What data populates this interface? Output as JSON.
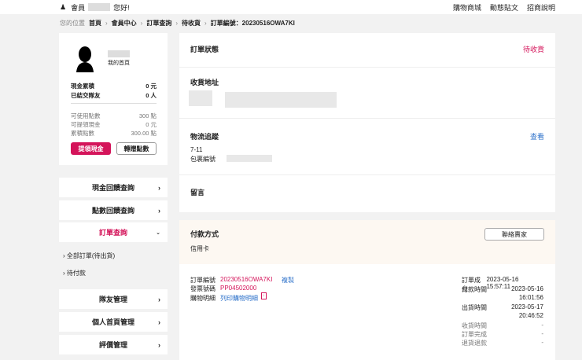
{
  "topbar": {
    "greeting_prefix": "會員",
    "greeting_suffix": "您好!",
    "nav": [
      "購物商城",
      "動態貼文",
      "招商說明"
    ]
  },
  "breadcrumb": {
    "label": "您的位置",
    "items": [
      "首頁",
      "會員中心",
      "訂單查詢",
      "待收貨",
      "訂單編號：20230516OWA7KI"
    ]
  },
  "profile": {
    "home_link": "我的首頁",
    "cash_total_label": "現金累積",
    "cash_total": "0 元",
    "friends_label": "已結交隊友",
    "friends": "0 人",
    "usable_points_label": "可使用點數",
    "usable_points": "300 點",
    "withdrawable_label": "可提領現金",
    "withdrawable": "0 元",
    "accum_points_label": "累積點數",
    "accum_points": "300.00 點",
    "withdraw_button": "提領現金",
    "transfer_button": "轉贈點數"
  },
  "menu": {
    "cash_rebate": "現金回饋查詢",
    "points_rebate": "點數回饋查詢",
    "orders": "訂單查詢",
    "orders_sub": [
      "全部訂單(待出貨)",
      "待付款"
    ],
    "team": "隊友管理",
    "homepage": "個人首頁管理",
    "reviews": "評價管理"
  },
  "order": {
    "status_label": "訂單狀態",
    "status": "待收貨",
    "address_label": "收貨地址",
    "logistics_label": "物流追蹤",
    "logistics_view": "查看",
    "carrier": "7-11",
    "package_label": "包裹編號",
    "message_label": "留言",
    "payment_label": "付款方式",
    "payment": "信用卡",
    "contact_seller": "聯絡賣家",
    "order_no_label": "訂單編號",
    "order_no": "20230516OWA7KI",
    "copy": "複製",
    "invoice_label": "發票號碼",
    "invoice": "PP04502000",
    "detail_label": "購物明細",
    "detail_link": "列印購物明細",
    "times": [
      {
        "label": "訂單成立",
        "value": "2023-05-16 15:57:11"
      },
      {
        "label": "付款時間",
        "value": "2023-05-16",
        "value2": "16:01:56"
      },
      {
        "label": "出貨時間",
        "value": "2023-05-17",
        "value2": "20:46:52"
      },
      {
        "label": "收貨時間",
        "value": "-"
      },
      {
        "label": "訂單完成",
        "value": "-"
      },
      {
        "label": "退貨退款",
        "value": "-"
      }
    ]
  },
  "colors": {
    "accent": "#d4145a",
    "link": "#2a6fc9"
  }
}
